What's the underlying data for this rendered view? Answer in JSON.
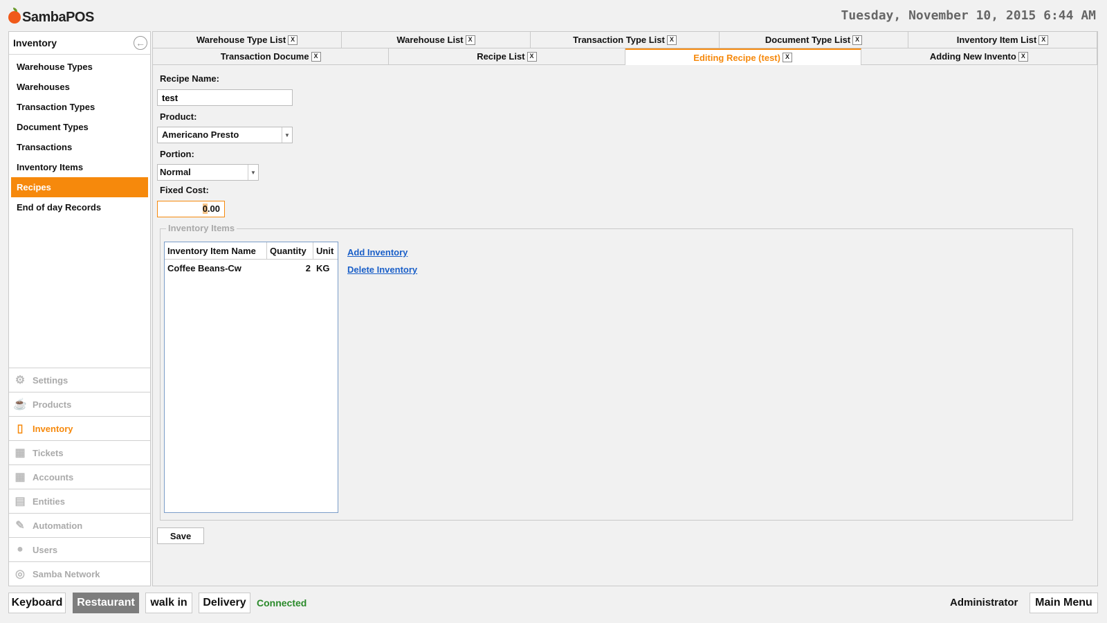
{
  "app": {
    "brand": "SambaPOS"
  },
  "clock": "Tuesday, November 10, 2015 6:44 AM",
  "left_panel": {
    "title": "Inventory",
    "items": [
      {
        "label": "Warehouse Types"
      },
      {
        "label": "Warehouses"
      },
      {
        "label": "Transaction Types"
      },
      {
        "label": "Document Types"
      },
      {
        "label": "Transactions"
      },
      {
        "label": "Inventory Items"
      },
      {
        "label": "Recipes",
        "active": true
      },
      {
        "label": "End of day Records"
      }
    ],
    "modules": [
      {
        "label": "Settings",
        "icon": "gear-icon"
      },
      {
        "label": "Products",
        "icon": "coffee-cup-icon"
      },
      {
        "label": "Inventory",
        "icon": "box-icon",
        "active": true
      },
      {
        "label": "Tickets",
        "icon": "books-icon"
      },
      {
        "label": "Accounts",
        "icon": "calculator-icon"
      },
      {
        "label": "Entities",
        "icon": "calendar-icon"
      },
      {
        "label": "Automation",
        "icon": "pencil-icon"
      },
      {
        "label": "Users",
        "icon": "user-icon"
      },
      {
        "label": "Samba Network",
        "icon": "globe-icon"
      }
    ]
  },
  "tabs_row1": [
    {
      "label": "Warehouse Type List",
      "close": "X"
    },
    {
      "label": "Warehouse List",
      "close": "X"
    },
    {
      "label": "Transaction Type List",
      "close": "X"
    },
    {
      "label": "Document Type List",
      "close": "X"
    },
    {
      "label": "Inventory Item List",
      "close": "X"
    }
  ],
  "tabs_row2": [
    {
      "label": "Transaction Docume",
      "close": "X"
    },
    {
      "label": "Recipe List",
      "close": "X"
    },
    {
      "label": "Editing Recipe (test)",
      "close": "X",
      "active": true
    },
    {
      "label": "Adding New Invento",
      "close": "X"
    }
  ],
  "form": {
    "recipe_name_label": "Recipe Name:",
    "recipe_name_value": "test",
    "product_label": "Product:",
    "product_value": "Americano Presto",
    "portion_label": "Portion:",
    "portion_value": "Normal",
    "fixed_cost_label": "Fixed Cost:",
    "fixed_cost_value_sel": "0",
    "fixed_cost_value_rest": ".00",
    "inventory_group_label": "Inventory Items",
    "grid_headers": {
      "name": "Inventory Item Name",
      "quantity": "Quantity",
      "unit": "Unit"
    },
    "grid_rows": [
      {
        "name": "Coffee Beans-Cw",
        "quantity": "2",
        "unit": "KG"
      }
    ],
    "add_inventory": "Add Inventory",
    "delete_inventory": "Delete Inventory",
    "save": "Save"
  },
  "bottom_bar": {
    "keyboard": "Keyboard",
    "restaurant": "Restaurant",
    "walk_in": "walk in",
    "delivery": "Delivery",
    "status": "Connected",
    "user": "Administrator",
    "main_menu": "Main Menu"
  },
  "colors": {
    "accent": "#f6890c",
    "link": "#1a5fc8",
    "connected": "#2a8a2a"
  }
}
